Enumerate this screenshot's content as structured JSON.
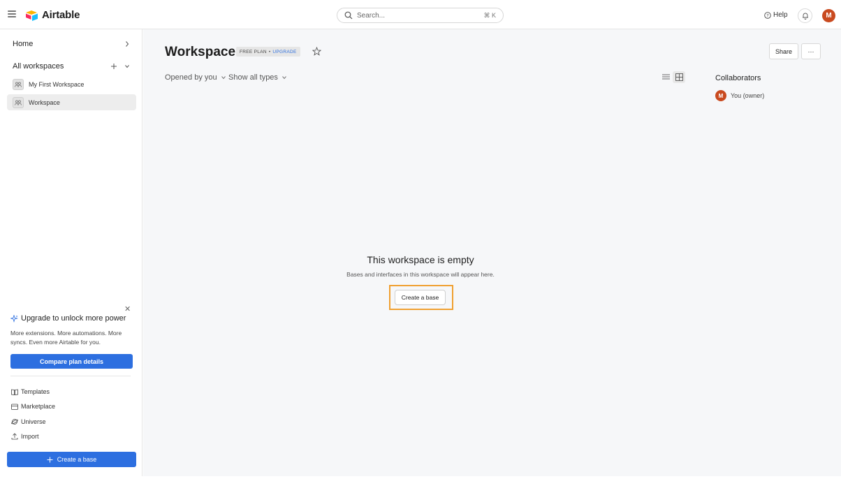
{
  "app": {
    "name": "Airtable"
  },
  "topbar": {
    "search_placeholder": "Search...",
    "search_shortcut": "⌘ K",
    "help_label": "Help",
    "avatar_initial": "M"
  },
  "sidebar": {
    "home_label": "Home",
    "all_workspaces_label": "All workspaces",
    "workspaces": [
      {
        "label": "My First Workspace",
        "active": false
      },
      {
        "label": "Workspace",
        "active": true
      }
    ],
    "promo": {
      "title": "Upgrade to unlock more power",
      "body": "More extensions. More automations. More syncs. Even more Airtable for you.",
      "button_label": "Compare plan details"
    },
    "links": [
      {
        "label": "Templates",
        "icon": "book-icon"
      },
      {
        "label": "Marketplace",
        "icon": "marketplace-icon"
      },
      {
        "label": "Universe",
        "icon": "globe-icon"
      },
      {
        "label": "Import",
        "icon": "upload-icon"
      }
    ],
    "create_base_label": "Create a base"
  },
  "main": {
    "title": "Workspace",
    "plan_badge": {
      "plan": "FREE PLAN",
      "separator": "•",
      "upgrade": "UPGRADE"
    },
    "share_label": "Share",
    "more_label": "···",
    "filters": {
      "opened_by": "Opened by you",
      "types": "Show all types"
    },
    "collaborators": {
      "title": "Collaborators",
      "items": [
        {
          "initial": "M",
          "name": "You (owner)"
        }
      ]
    },
    "empty": {
      "title": "This workspace is empty",
      "subtitle": "Bases and interfaces in this workspace will appear here.",
      "button_label": "Create a base"
    }
  },
  "colors": {
    "accent": "#2d6fe0",
    "avatar": "#c94a1f",
    "highlight": "#f0a030"
  }
}
